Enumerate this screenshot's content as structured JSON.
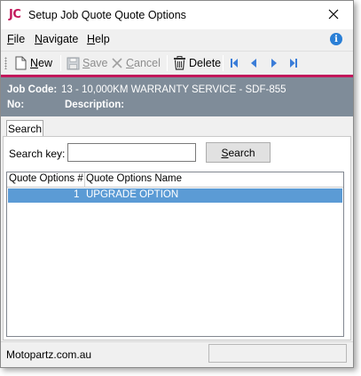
{
  "window": {
    "app_logo": "JC",
    "title": "Setup Job Quote Quote Options"
  },
  "menu": {
    "file": {
      "underline": "F",
      "rest": "ile"
    },
    "navigate": {
      "underline": "N",
      "rest": "avigate"
    },
    "help": {
      "underline": "H",
      "rest": "elp"
    }
  },
  "toolbar": {
    "new": {
      "underline": "N",
      "rest": "ew"
    },
    "save": {
      "underline": "S",
      "rest": "ave"
    },
    "cancel": {
      "underline": "C",
      "rest": "ancel"
    },
    "delete": "Delete"
  },
  "header": {
    "job_code_label": "Job Code:",
    "job_code_value": "13 - 10,000KM WARRANTY SERVICE - SDF-855",
    "no_label": "No:",
    "description_label": "Description:"
  },
  "tabs": [
    {
      "label": "Search",
      "active": true
    }
  ],
  "search": {
    "label": "Search key:",
    "value": "",
    "button": {
      "underline": "S",
      "rest": "earch"
    }
  },
  "grid": {
    "columns": [
      "Quote Options #",
      "Quote Options Name"
    ],
    "rows": [
      {
        "number": "1",
        "name": "UPGRADE OPTION",
        "selected": true
      }
    ]
  },
  "status": {
    "text": "Motopartz.com.au"
  },
  "colors": {
    "accent": "#c2185b",
    "header_band": "#7f8c99",
    "selection": "#5b9bd5",
    "info": "#2a7fd6"
  },
  "icons": [
    "close-icon",
    "info-icon",
    "new-document-icon",
    "save-icon",
    "cancel-icon",
    "delete-icon",
    "first-record-icon",
    "previous-record-icon",
    "next-record-icon",
    "last-record-icon"
  ]
}
